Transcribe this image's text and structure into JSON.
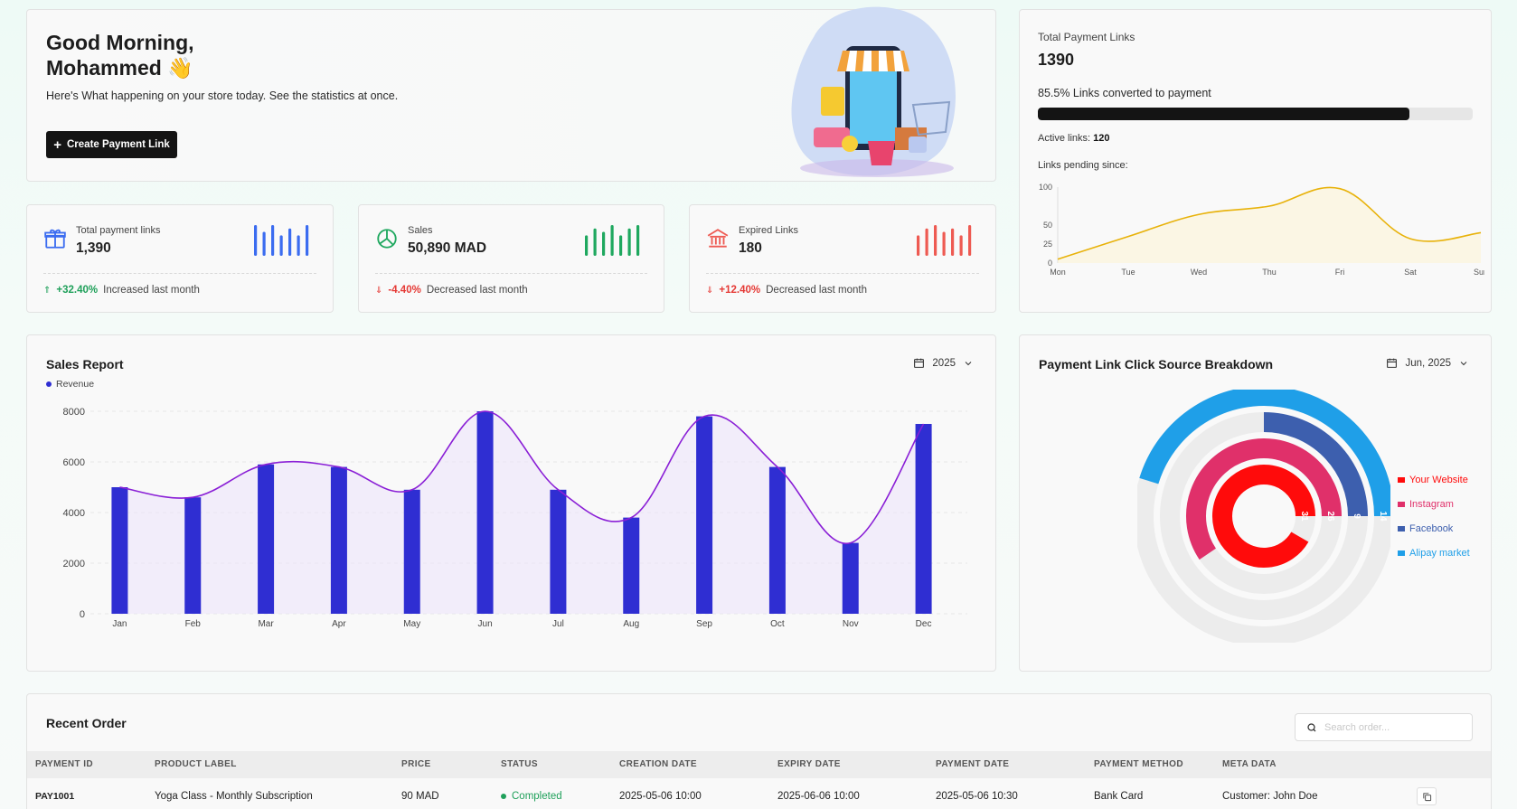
{
  "greeting": {
    "line1": "Good Morning,",
    "line2": "Mohammed 👋",
    "subtitle": "Here's What happening on your store today. See the statistics at once.",
    "create_button": "Create Payment Link"
  },
  "stats": [
    {
      "icon": "gift-icon",
      "label": "Total payment links",
      "value": "1,390",
      "change": "+32.40%",
      "trend": "up",
      "note": "Increased last month",
      "color": "#3b6cf0",
      "bars": [
        9,
        7,
        9,
        6,
        8,
        6,
        9
      ]
    },
    {
      "icon": "pie-chart-icon",
      "label": "Sales",
      "value": "50,890 MAD",
      "change": "-4.40%",
      "trend": "down",
      "note": "Decreased last month",
      "color": "#1fa85f",
      "bars": [
        6,
        8,
        7,
        9,
        6,
        8,
        9
      ]
    },
    {
      "icon": "bank-icon",
      "label": "Expired Links",
      "value": "180",
      "change": "+12.40%",
      "trend": "down",
      "note": "Decreased last month",
      "color": "#ee5a52",
      "bars": [
        6,
        8,
        9,
        7,
        8,
        6,
        9
      ]
    }
  ],
  "links_card": {
    "label": "Total Payment Links",
    "value": "1390",
    "conversion_text": "85.5% Links converted to payment",
    "conversion_pct": 85.5,
    "active_label": "Active links:",
    "active_value": "120",
    "pending_label": "Links pending since:"
  },
  "sales_report": {
    "title": "Sales Report",
    "legend": "Revenue",
    "year": "2025"
  },
  "breakdown": {
    "title": "Payment Link Click Source Breakdown",
    "period": "Jun, 2025"
  },
  "chart_data": [
    {
      "type": "line",
      "title": "Links pending since:",
      "categories": [
        "Mon",
        "Tue",
        "Wed",
        "Thu",
        "Fri",
        "Sat",
        "Sun"
      ],
      "values": [
        5,
        35,
        64,
        75,
        98,
        32,
        40
      ],
      "yticks": [
        0,
        25,
        50,
        100
      ],
      "ylim": [
        0,
        100
      ],
      "color": "#e8b20a",
      "grid": false
    },
    {
      "type": "bar",
      "title": "Sales Report",
      "categories": [
        "Jan",
        "Feb",
        "Mar",
        "Apr",
        "May",
        "Jun",
        "Jul",
        "Aug",
        "Sep",
        "Oct",
        "Nov",
        "Dec"
      ],
      "series": [
        {
          "name": "Revenue",
          "values": [
            5000,
            4600,
            5900,
            5800,
            4900,
            8000,
            4900,
            3800,
            7800,
            5800,
            2800,
            7500
          ]
        }
      ],
      "yticks": [
        0,
        2000,
        4000,
        6000,
        8000
      ],
      "ylim": [
        0,
        8000
      ],
      "bar_color": "#2f2ed2",
      "line_color": "#8a1fd6",
      "grid": true
    },
    {
      "type": "radial_bar",
      "title": "Payment Link Click Source Breakdown",
      "series": [
        {
          "name": "Your Website",
          "value": 31,
          "color": "#ff0b0b"
        },
        {
          "name": "Instagram",
          "value": 26,
          "color": "#e0306a"
        },
        {
          "name": "Facebook",
          "value": 9,
          "color": "#3d5fae"
        },
        {
          "name": "Alipay market",
          "value": 14,
          "color": "#1f9fe8"
        }
      ],
      "legend": "right"
    }
  ],
  "orders": {
    "title": "Recent Order",
    "search_placeholder": "Search order...",
    "columns": [
      "PAYMENT ID",
      "PRODUCT LABEL",
      "PRICE",
      "STATUS",
      "CREATION DATE",
      "EXPIRY DATE",
      "PAYMENT DATE",
      "PAYMENT METHOD",
      "META DATA"
    ],
    "rows": [
      [
        "PAY1001",
        "Yoga Class - Monthly Subscription",
        "90 MAD",
        "Completed",
        "2025-05-06 10:00",
        "2025-06-06 10:00",
        "2025-05-06 10:30",
        "Bank Card",
        "Customer: John Doe"
      ]
    ]
  }
}
